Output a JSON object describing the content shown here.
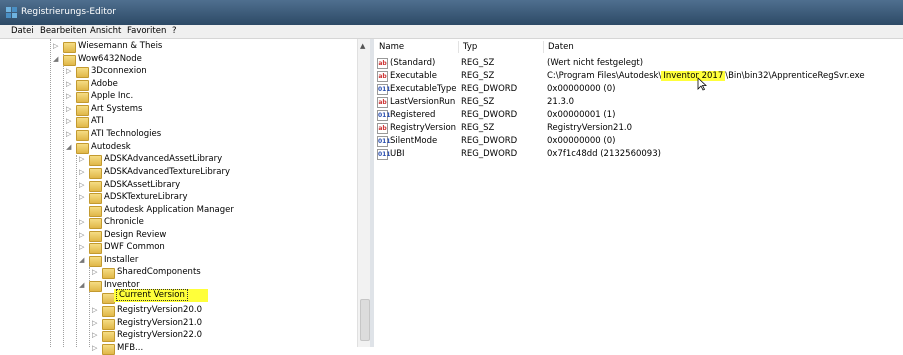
{
  "window": {
    "title": "Registrierungs-Editor"
  },
  "menu": [
    "Datei",
    "Bearbeiten",
    "Ansicht",
    "Favoriten",
    "?"
  ],
  "tree": [
    {
      "label": "Wiesemann & Theis",
      "toggle": "▷"
    },
    {
      "label": "Wow6432Node",
      "toggle": "◢"
    },
    {
      "label": "3Dconnexion",
      "toggle": "▷"
    },
    {
      "label": "Adobe",
      "toggle": "▷"
    },
    {
      "label": "Apple Inc.",
      "toggle": "▷"
    },
    {
      "label": "Art Systems",
      "toggle": "▷"
    },
    {
      "label": "ATI",
      "toggle": "▷"
    },
    {
      "label": "ATI Technologies",
      "toggle": "▷"
    },
    {
      "label": "Autodesk",
      "toggle": "◢"
    },
    {
      "label": "ADSKAdvancedAssetLibrary",
      "toggle": "▷"
    },
    {
      "label": "ADSKAdvancedTextureLibrary",
      "toggle": "▷"
    },
    {
      "label": "ADSKAssetLibrary",
      "toggle": "▷"
    },
    {
      "label": "ADSKTextureLibrary",
      "toggle": "▷"
    },
    {
      "label": "Autodesk Application Manager",
      "toggle": ""
    },
    {
      "label": "Chronicle",
      "toggle": "▷"
    },
    {
      "label": "Design Review",
      "toggle": "▷"
    },
    {
      "label": "DWF Common",
      "toggle": "▷"
    },
    {
      "label": "Installer",
      "toggle": "◢"
    },
    {
      "label": "SharedComponents",
      "toggle": "▷"
    },
    {
      "label": "Inventor",
      "toggle": "◢"
    },
    {
      "label": "Current Version",
      "toggle": ""
    },
    {
      "label": "RegistryVersion20.0",
      "toggle": "▷"
    },
    {
      "label": "RegistryVersion21.0",
      "toggle": "▷"
    },
    {
      "label": "RegistryVersion22.0",
      "toggle": "▷"
    },
    {
      "label": "MFB...",
      "toggle": "▷"
    }
  ],
  "list": {
    "headers": {
      "name": "Name",
      "type": "Typ",
      "data": "Daten"
    },
    "rows": [
      {
        "icon": "ab",
        "name": "(Standard)",
        "type": "REG_SZ",
        "data": "(Wert nicht festgelegt)"
      },
      {
        "icon": "ab",
        "name": "Executable",
        "type": "REG_SZ",
        "data_pre": "C:\\Program Files\\Autodesk\\",
        "data_hl": "Inventor 2017",
        "data_post": "\\Bin\\bin32\\ApprenticeRegSvr.exe"
      },
      {
        "icon": "011",
        "name": "ExecutableType",
        "type": "REG_DWORD",
        "data": "0x00000000 (0)"
      },
      {
        "icon": "ab",
        "name": "LastVersionRun",
        "type": "REG_SZ",
        "data": "21.3.0"
      },
      {
        "icon": "011",
        "name": "Registered",
        "type": "REG_DWORD",
        "data": "0x00000001 (1)"
      },
      {
        "icon": "ab",
        "name": "RegistryVersion",
        "type": "REG_SZ",
        "data": "RegistryVersion21.0"
      },
      {
        "icon": "011",
        "name": "SilentMode",
        "type": "REG_DWORD",
        "data": "0x00000000 (0)"
      },
      {
        "icon": "011",
        "name": "UBI",
        "type": "REG_DWORD",
        "data": "0x7f1c48dd (2132560093)"
      }
    ]
  },
  "colors": {
    "highlight": "#ffff3a",
    "titlebar": "#3a5a7a"
  }
}
